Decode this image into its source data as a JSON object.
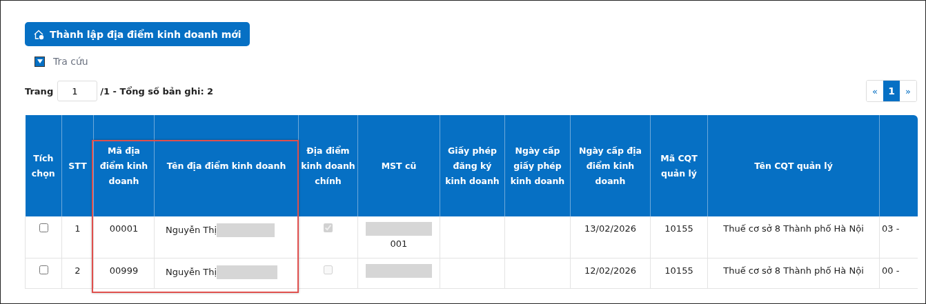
{
  "create_button": {
    "label": "Thành lập địa điểm kinh doanh mới"
  },
  "search_toggle": {
    "label": "Tra cứu",
    "expanded": false
  },
  "pager": {
    "page_label": "Trang",
    "page_value": "1",
    "summary": "/1 - Tổng số bản ghi: 2",
    "prev": "«",
    "pages": [
      {
        "label": "1",
        "selected": true
      }
    ],
    "next": "»"
  },
  "highlight": {
    "kind": "box",
    "color": "#e0504d"
  },
  "table": {
    "columns": [
      "Tích chọn",
      "STT",
      "Mã địa điểm kinh doanh",
      "Tên địa điểm kinh doanh",
      "Địa điểm kinh doanh chính",
      "MST cũ",
      "Giấy phép đăng ký kinh doanh",
      "Ngày cấp giấy phép kinh doanh",
      "Ngày cấp địa điểm kinh doanh",
      "Mã CQT quản lý",
      "Tên CQT quản lý"
    ],
    "rows": [
      {
        "selected": false,
        "stt": "1",
        "code": "00001",
        "name": "Nguyễn Thị",
        "name_redacted": true,
        "main": true,
        "old_tax_redacted": true,
        "old_tax": "001",
        "issue_date": "13/02/2026",
        "authority_code": "10155",
        "authority_name": "Thuế cơ sở 8 Thành phố Hà Nội",
        "column_12": "03 -"
      },
      {
        "selected": false,
        "stt": "2",
        "code": "00999",
        "name": "Nguyễn Thị",
        "name_redacted": true,
        "main": false,
        "old_tax_redacted": true,
        "issue_date": "12/02/2026",
        "authority_code": "10155",
        "authority_name": "Thuế cơ sở 8 Thành phố Hà Nội",
        "column_12": "00 -"
      }
    ]
  }
}
